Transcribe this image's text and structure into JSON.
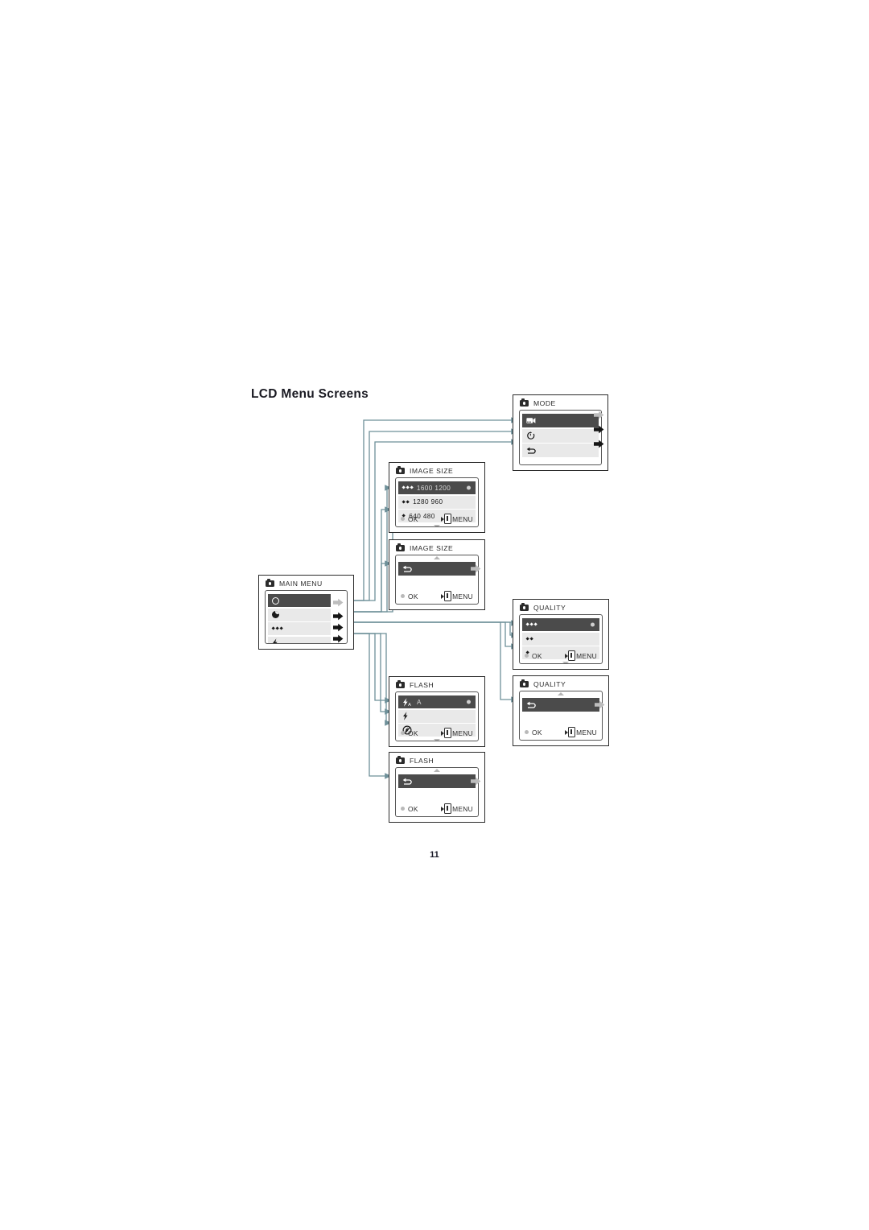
{
  "document": {
    "title": "LCD Menu Screens",
    "page_number": "11"
  },
  "colors": {
    "row_selected_bg": "#4b4b4b",
    "row_bg": "#e9e9e9",
    "panel_border": "#2b2b2b",
    "connector": "#6e9099",
    "text": "#1a1a1a"
  },
  "common": {
    "ok_label": "OK",
    "menu_label": "MENU",
    "camera_icon": "camera-icon"
  },
  "panels": {
    "mode": {
      "title": "MODE",
      "rows": [
        {
          "icon": "movie-camera-icon",
          "label": "",
          "selected": true,
          "arrow": "gray"
        },
        {
          "icon": "self-timer-icon",
          "label": "",
          "selected": false,
          "arrow": "black"
        },
        {
          "icon": "return-arrow-icon",
          "label": "",
          "selected": false,
          "arrow": "black"
        }
      ]
    },
    "image_size": {
      "title": "IMAGE SIZE",
      "rows": [
        {
          "icon": "three-diamonds-icon",
          "label": "1600  1200",
          "selected": true,
          "bullet": true
        },
        {
          "icon": "two-diamonds-icon",
          "label": "1280  960",
          "selected": false,
          "bullet": false
        },
        {
          "icon": "one-diamond-icon",
          "label": "640  480",
          "selected": false,
          "bullet": false
        }
      ],
      "ok_label": "OK",
      "menu_label": "MENU"
    },
    "image_size_back": {
      "title": "IMAGE SIZE",
      "rows": [
        {
          "icon": "return-arrow-icon",
          "label": "",
          "selected": true,
          "arrow": "gray"
        }
      ],
      "ok_label": "OK",
      "menu_label": "MENU"
    },
    "main_menu": {
      "title": "MAIN MENU",
      "rows": [
        {
          "icon": "circle-outline-icon",
          "label": "",
          "selected": true,
          "arrow": "gray"
        },
        {
          "icon": "half-circle-icon",
          "label": "",
          "selected": false,
          "arrow": "black"
        },
        {
          "icon": "three-diamonds-icon",
          "label": "",
          "selected": false,
          "arrow": "black"
        },
        {
          "icon": "flash-bolt-icon",
          "label": "",
          "selected": false,
          "arrow": "black"
        }
      ]
    },
    "quality": {
      "title": "QUALITY",
      "rows": [
        {
          "icon": "three-diamonds-icon",
          "label": "",
          "selected": true,
          "bullet": true
        },
        {
          "icon": "two-diamonds-icon",
          "label": "",
          "selected": false,
          "bullet": false
        },
        {
          "icon": "one-diamond-icon",
          "label": "",
          "selected": false,
          "bullet": false
        }
      ],
      "ok_label": "OK",
      "menu_label": "MENU"
    },
    "quality_back": {
      "title": "QUALITY",
      "rows": [
        {
          "icon": "return-arrow-icon",
          "label": "",
          "selected": true,
          "arrow": "gray"
        }
      ],
      "ok_label": "OK",
      "menu_label": "MENU"
    },
    "flash": {
      "title": "FLASH",
      "rows": [
        {
          "icon": "flash-auto-icon",
          "label": "A",
          "selected": true,
          "bullet": true
        },
        {
          "icon": "flash-on-icon",
          "label": "",
          "selected": false,
          "bullet": false
        },
        {
          "icon": "flash-off-icon",
          "label": "",
          "selected": false,
          "bullet": false
        }
      ],
      "ok_label": "OK",
      "menu_label": "MENU"
    },
    "flash_back": {
      "title": "FLASH",
      "rows": [
        {
          "icon": "return-arrow-icon",
          "label": "",
          "selected": true,
          "arrow": "gray"
        }
      ],
      "ok_label": "OK",
      "menu_label": "MENU"
    }
  }
}
